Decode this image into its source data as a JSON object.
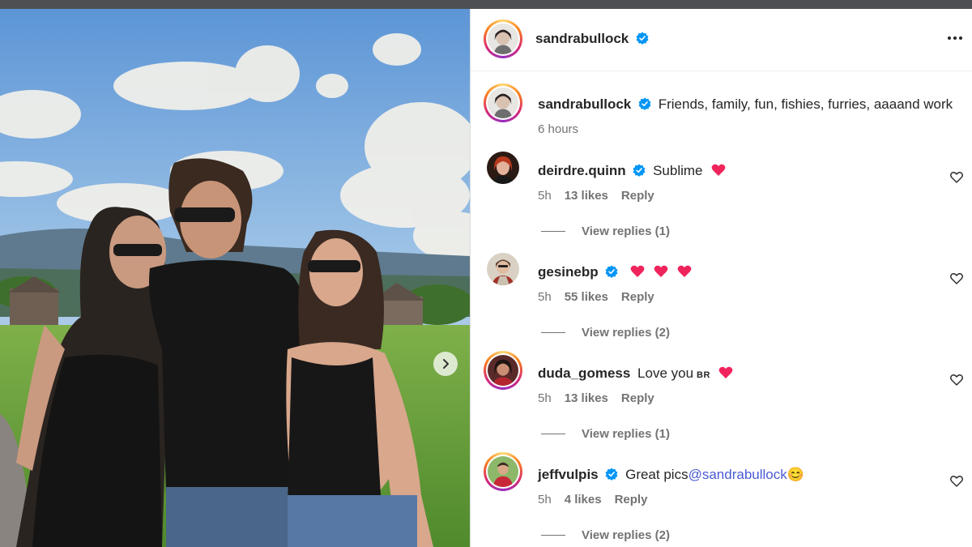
{
  "post": {
    "author": "sandrabullock",
    "caption": "Friends, family, fun, fishies, furries, aaaand work",
    "time": "6 hours",
    "photo_alt": "Three friends posing outdoors in front of a barn and field"
  },
  "comments": [
    {
      "user": "deirdre.quinn",
      "text": "Sublime",
      "hearts": 1,
      "time": "5h",
      "likes": "13 likes",
      "reply": "Reply",
      "view_replies": "View replies (1)"
    },
    {
      "user": "gesinebp",
      "text": "",
      "hearts": 3,
      "time": "5h",
      "likes": "55 likes",
      "reply": "Reply",
      "view_replies": "View replies (2)"
    },
    {
      "user": "duda_gomess",
      "text": "Love you",
      "flag": "BR",
      "hearts": 1,
      "time": "5h",
      "likes": "13 likes",
      "reply": "Reply",
      "view_replies": "View replies (1)"
    },
    {
      "user": "jeffvulpis",
      "text": "Great pics",
      "mention": "@sandrabullock",
      "emoji": "😊",
      "hearts": 0,
      "time": "5h",
      "likes": "4 likes",
      "reply": "Reply",
      "view_replies": "View replies (2)"
    }
  ],
  "icons": {
    "verified": "verified-badge-icon",
    "heart": "heart-emoji-icon",
    "like": "heart-outline-icon",
    "more": "more-options-icon",
    "next": "chevron-right-icon"
  },
  "colors": {
    "verified": "#0095f6",
    "heart": "#f0245c",
    "mention": "#4a5bd4",
    "muted": "#737373"
  }
}
